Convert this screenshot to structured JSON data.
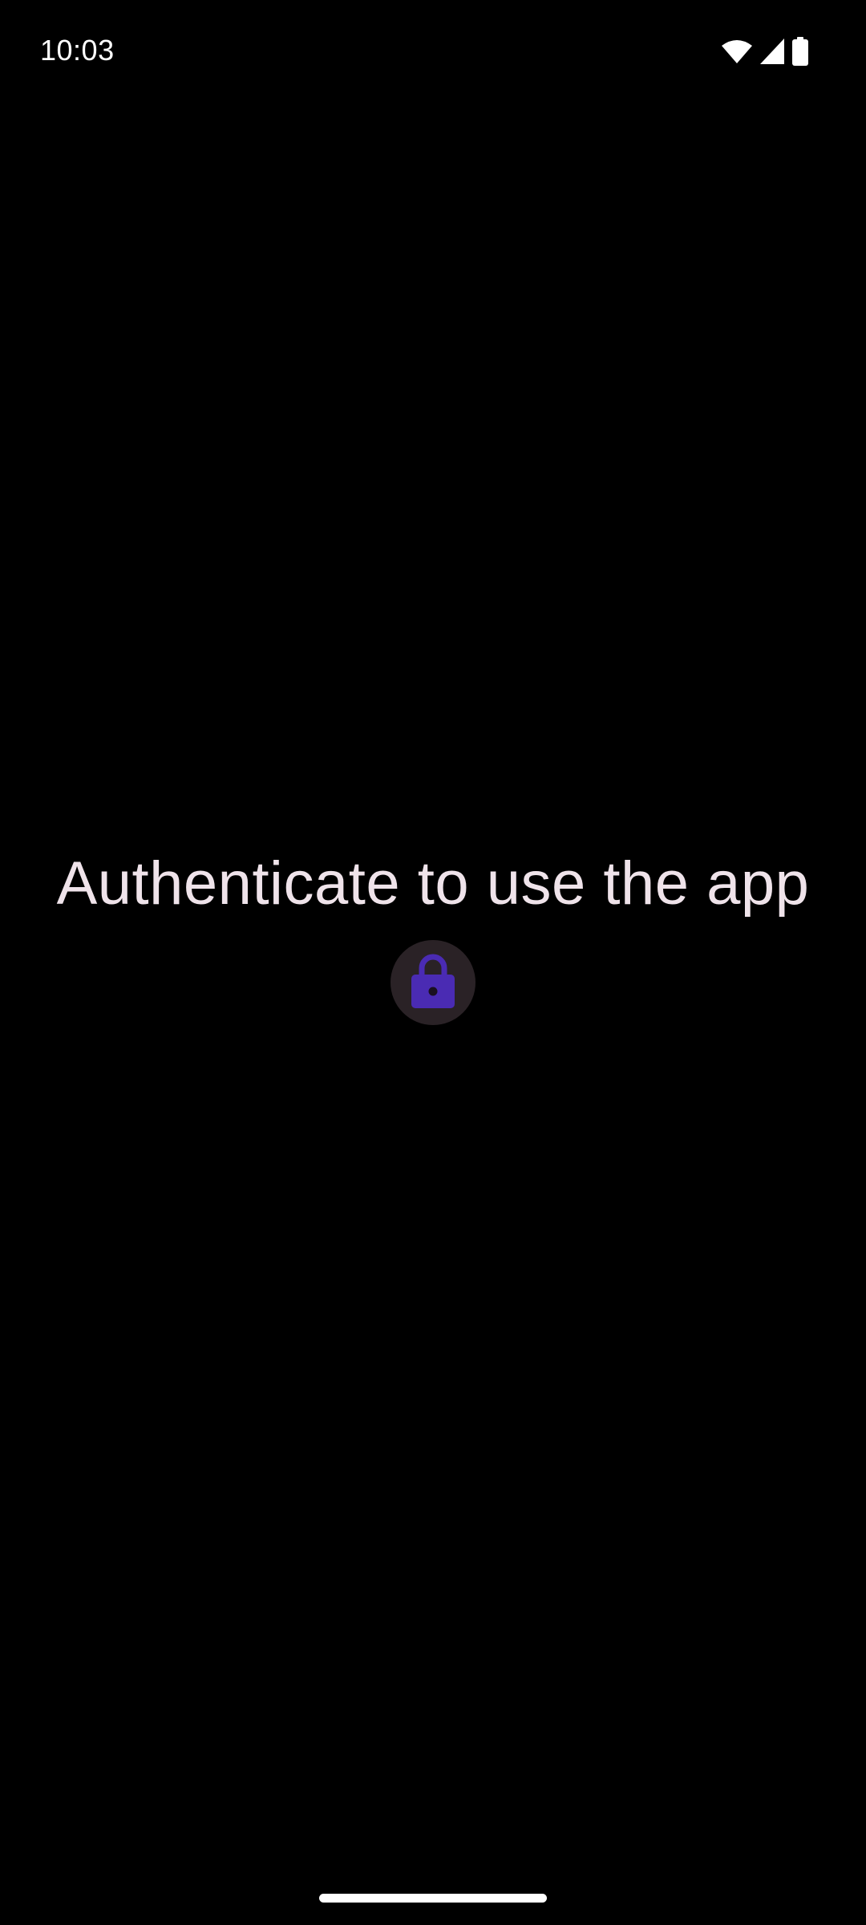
{
  "status_bar": {
    "time": "10:03",
    "icons": [
      "wifi-icon",
      "cell-signal-icon",
      "battery-icon"
    ]
  },
  "main": {
    "title": "Authenticate to use the app",
    "lock_button": {
      "icon": "lock-icon",
      "icon_color": "#4a2bb3",
      "background_color": "#2a2226"
    }
  },
  "colors": {
    "background": "#000000",
    "title_text": "#efe3ea",
    "status_text": "#ffffff"
  }
}
